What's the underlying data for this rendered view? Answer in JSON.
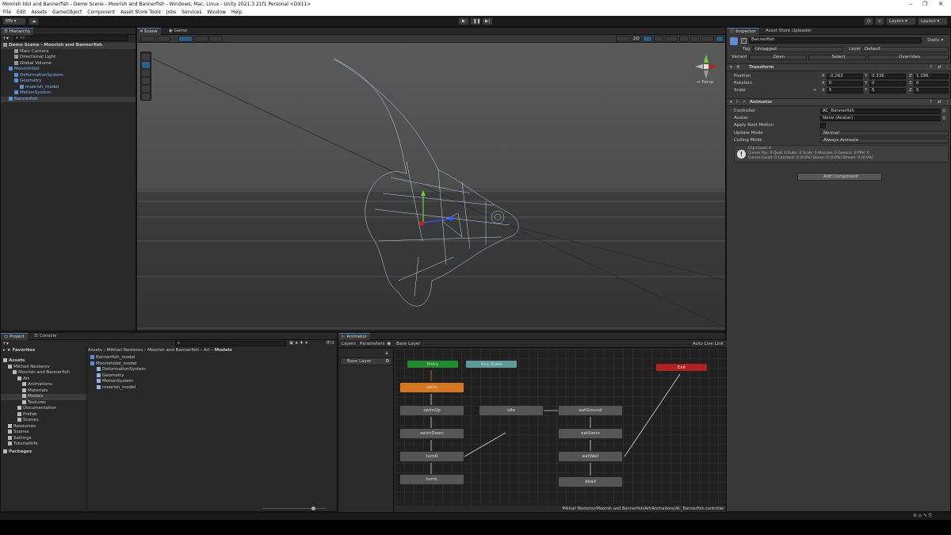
{
  "window": {
    "title": "Moorish Idol and Bannerfish - Demo Scene - Moorish and Bannerfish - Windows, Mac, Linux - Unity 2021.3.21f1 Personal <DX11>"
  },
  "menu": [
    "File",
    "Edit",
    "Assets",
    "GameObject",
    "Component",
    "Asset Store Tools",
    "Jobs",
    "Services",
    "Window",
    "Help"
  ],
  "toolbar": {
    "account": "MN",
    "layers": "Layers",
    "layout": "Layout"
  },
  "hierarchy": {
    "tab": "Hierarchy",
    "search_placeholder": "All",
    "items": [
      {
        "label": "Demo Scene - Moorish and Bannerfish",
        "indent": 0,
        "style": "scene"
      },
      {
        "label": "Main Camera",
        "indent": 2,
        "style": "normal"
      },
      {
        "label": "Directional Light",
        "indent": 2,
        "style": "normal"
      },
      {
        "label": "Global Volume",
        "indent": 2,
        "style": "normal"
      },
      {
        "label": "MoorishIdol",
        "indent": 1,
        "style": "prefab"
      },
      {
        "label": "DeformationSystem",
        "indent": 2,
        "style": "prefab"
      },
      {
        "label": "Geometry",
        "indent": 2,
        "style": "prefab"
      },
      {
        "label": "moorish_model",
        "indent": 3,
        "style": "prefab"
      },
      {
        "label": "MotionSystem",
        "indent": 2,
        "style": "prefab"
      },
      {
        "label": "Bannerfish",
        "indent": 1,
        "style": "selected"
      }
    ]
  },
  "scene": {
    "tab_scene": "Scene",
    "tab_game": "Game",
    "mode_2d": "2D",
    "persp": "Persp"
  },
  "inspector": {
    "tab": "Inspector",
    "tab2": "Asset Store Uploader",
    "object_name": "Bannerfish",
    "static": "Static",
    "tag_label": "Tag",
    "tag_value": "Untagged",
    "layer_label": "Layer",
    "layer_value": "Default",
    "variant_label": "Variant",
    "open": "Open",
    "select": "Select",
    "overrides": "Overrides",
    "transform": {
      "title": "Transform",
      "position_label": "Position",
      "position": {
        "x": "-0.263",
        "y": "0.336",
        "z": "1.196"
      },
      "rotation_label": "Rotation",
      "rotation": {
        "x": "0",
        "y": "0",
        "z": "0"
      },
      "scale_label": "Scale",
      "scale": {
        "x": "5",
        "y": "5",
        "z": "5"
      }
    },
    "animator": {
      "title": "Animator",
      "controller_label": "Controller",
      "controller_value": "AC_Bannerfish",
      "avatar_label": "Avatar",
      "avatar_value": "None (Avatar)",
      "root_motion_label": "Apply Root Motion",
      "update_mode_label": "Update Mode",
      "update_mode_value": "Normal",
      "culling_label": "Culling Mode",
      "culling_value": "Always Animate",
      "info_line1": "Clip Count: 0",
      "info_line2": "Curves Pos: 0 Quat: 0 Euler: 0 Scale: 0 Muscles: 0 Generic: 0 PPtr: 0",
      "info_line3": "Curves Count: 0 Constant: 0 (0.0%) Dense: 0 (0.0%) Stream: 0 (0.0%)"
    },
    "add_component": "Add Component"
  },
  "project": {
    "tab_project": "Project",
    "tab_console": "Console",
    "favorites": "Favorites",
    "tree": [
      {
        "label": "Assets",
        "indent": 0,
        "bold": true
      },
      {
        "label": "Mikhail Nesterov",
        "indent": 1
      },
      {
        "label": "Moorish and Bannerfish",
        "indent": 2
      },
      {
        "label": "Art",
        "indent": 3
      },
      {
        "label": "Animations",
        "indent": 4
      },
      {
        "label": "Materials",
        "indent": 4
      },
      {
        "label": "Models",
        "indent": 4,
        "selected": true
      },
      {
        "label": "Textures",
        "indent": 4
      },
      {
        "label": "Documentation",
        "indent": 3
      },
      {
        "label": "Prefab",
        "indent": 3
      },
      {
        "label": "Scenes",
        "indent": 3
      },
      {
        "label": "Resources",
        "indent": 1
      },
      {
        "label": "Scenes",
        "indent": 1
      },
      {
        "label": "Settings",
        "indent": 1
      },
      {
        "label": "TutorialInfo",
        "indent": 1
      },
      {
        "label": "Packages",
        "indent": 0,
        "bold": true
      }
    ],
    "breadcrumb": [
      "Assets",
      "Mikhail Nesterov",
      "Moorish and Bannerfish",
      "Art",
      "Models"
    ],
    "files": [
      {
        "label": "Bannerfish_model",
        "indent": 0
      },
      {
        "label": "MoorishIdol_model",
        "indent": 0
      },
      {
        "label": "DeformationSystem",
        "indent": 1
      },
      {
        "label": "Geometry",
        "indent": 1
      },
      {
        "label": "MotionSystem",
        "indent": 1
      },
      {
        "label": "moorish_model",
        "indent": 1
      }
    ],
    "hidden_count": "9"
  },
  "animator": {
    "tab": "Animator",
    "layers_tab": "Layers",
    "parameters_tab": "Parameters",
    "breadcrumb": "Base Layer",
    "base_layer": "Base Layer",
    "auto_live_link": "Auto Live Link",
    "path": "Mikhail Nesterov/Moorish and Bannerfish/Art/Animations/AC_Bannerfish.controller",
    "nodes": {
      "entry": "Entry",
      "any_state": "Any State",
      "exit": "Exit",
      "swim": "swim",
      "swimUp": "swimUp",
      "swimDown": "swimDown",
      "turnR": "turnR",
      "turnL": "turnL",
      "idle": "idle",
      "eatGround": "eatGround",
      "eatSwim": "eatSwim",
      "eatWall": "eatWall",
      "dead": "dead"
    }
  },
  "colors": {
    "entry": "#1f8a2c",
    "any_state": "#5b9a95",
    "exit": "#b02121",
    "default_state": "#d5771c",
    "state": "#5b5b5b",
    "selection": "#2c5d87",
    "prefab_text": "#7fb6ff"
  }
}
